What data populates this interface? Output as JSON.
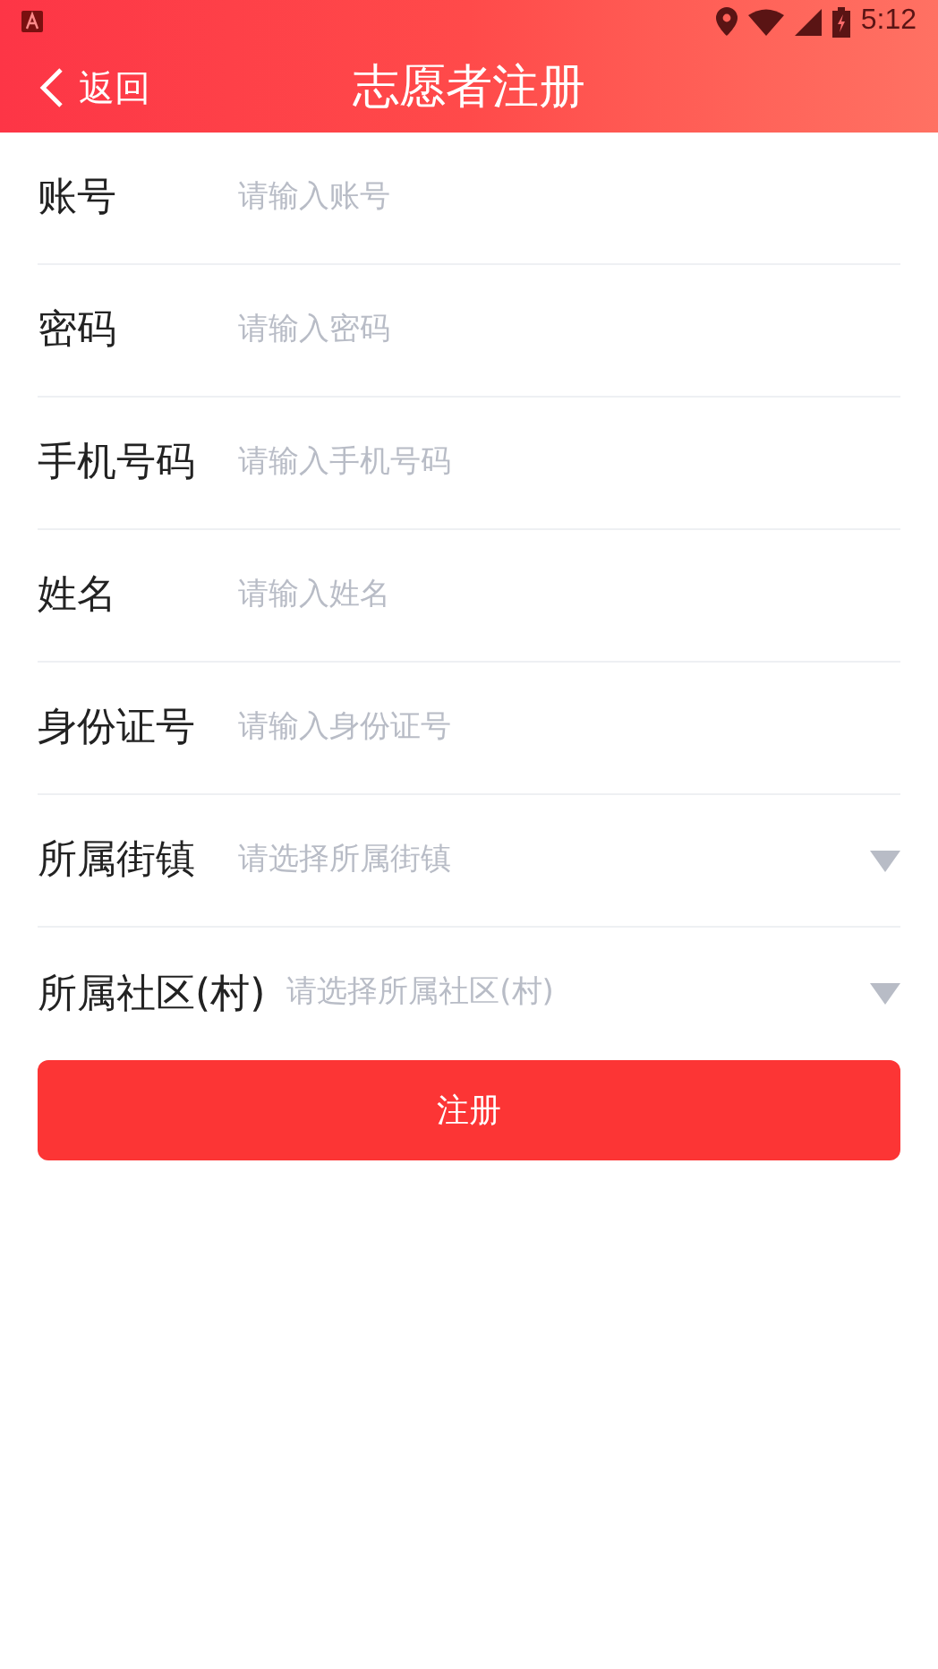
{
  "status_bar": {
    "time": "5:12"
  },
  "header": {
    "back": "返回",
    "title": "志愿者注册"
  },
  "fields": [
    {
      "kind": "text",
      "label": "账号",
      "placeholder": "请输入账号"
    },
    {
      "kind": "text",
      "label": "密码",
      "placeholder": "请输入密码"
    },
    {
      "kind": "text",
      "label": "手机号码",
      "placeholder": "请输入手机号码"
    },
    {
      "kind": "text",
      "label": "姓名",
      "placeholder": "请输入姓名"
    },
    {
      "kind": "text",
      "label": "身份证号",
      "placeholder": "请输入身份证号"
    },
    {
      "kind": "select",
      "label": "所属街镇",
      "placeholder": "请选择所属街镇"
    },
    {
      "kind": "select",
      "label": "所属社区(村)",
      "placeholder": "请选择所属社区(村)"
    }
  ],
  "submit": "注册"
}
